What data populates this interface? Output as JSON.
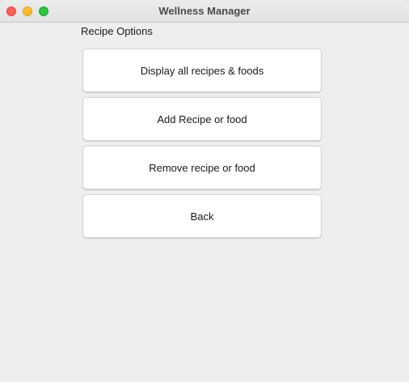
{
  "window": {
    "title": "Wellness Manager"
  },
  "section": {
    "label": "Recipe Options"
  },
  "buttons": {
    "display_all": "Display all recipes & foods",
    "add": "Add Recipe or food",
    "remove": "Remove recipe or food",
    "back": "Back"
  },
  "colors": {
    "close": "#fe5f57",
    "minimize": "#febc2e",
    "maximize": "#28c840",
    "window_bg": "#eeeeee",
    "button_bg": "#ffffff"
  }
}
